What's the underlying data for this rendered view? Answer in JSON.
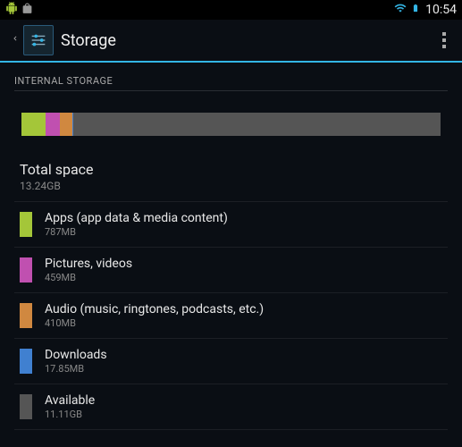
{
  "statusbar": {
    "time": "10:54"
  },
  "header": {
    "title": "Storage"
  },
  "section_label": "INTERNAL STORAGE",
  "total": {
    "label": "Total space",
    "value": "13.24GB"
  },
  "colors": {
    "apps": "#a4c639",
    "pictures": "#c050b0",
    "audio": "#d08840",
    "downloads": "#4080d0",
    "available": "#555555"
  },
  "items": [
    {
      "key": "apps",
      "label": "Apps (app data & media content)",
      "size": "787MB"
    },
    {
      "key": "pictures",
      "label": "Pictures, videos",
      "size": "459MB"
    },
    {
      "key": "audio",
      "label": "Audio (music, ringtones, podcasts, etc.)",
      "size": "410MB"
    },
    {
      "key": "downloads",
      "label": "Downloads",
      "size": "17.85MB"
    },
    {
      "key": "available",
      "label": "Available",
      "size": "11.11GB"
    }
  ],
  "chart_data": {
    "type": "bar",
    "title": "Internal storage usage",
    "total_gb": 13.24,
    "segments": [
      {
        "name": "Apps",
        "mb": 787,
        "color": "#a4c639"
      },
      {
        "name": "Pictures, videos",
        "mb": 459,
        "color": "#c050b0"
      },
      {
        "name": "Audio",
        "mb": 410,
        "color": "#d08840"
      },
      {
        "name": "Downloads",
        "mb": 17.85,
        "color": "#4080d0"
      },
      {
        "name": "Available",
        "mb": 11376.64,
        "color": "#555555"
      }
    ]
  }
}
